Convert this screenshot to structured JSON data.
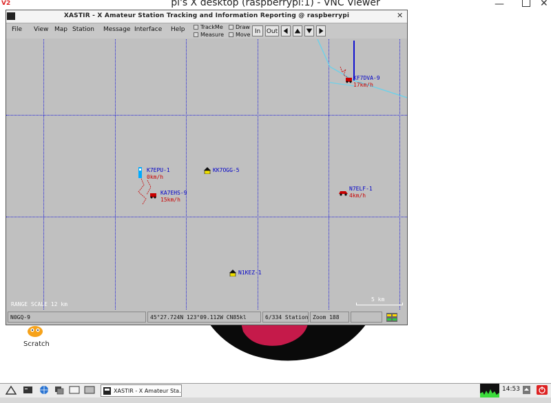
{
  "vnc": {
    "title": "pi's X desktop (raspberrypi:1) - VNC Viewer",
    "app_icon_text": "V2",
    "minimize_glyph": "—",
    "close_glyph": "✕"
  },
  "desktop": {
    "scratch_label": "Scratch"
  },
  "xastir": {
    "title": "XASTIR - X Amateur Station Tracking and Information Reporting @ raspberrypi",
    "close_glyph": "✕",
    "menus": [
      "File",
      "View",
      "Map",
      "Station",
      "Message",
      "Interface",
      "Help"
    ],
    "checkboxes": [
      {
        "label": "TrackMe"
      },
      {
        "label": "Draw"
      },
      {
        "label": "Measure"
      },
      {
        "label": "Move"
      }
    ],
    "zoom_in_label": "In",
    "zoom_out_label": "Out",
    "arrows": [
      "left",
      "up",
      "down",
      "right"
    ],
    "map": {
      "range_scale": "RANGE SCALE 12 km",
      "scale_bar_label": "5 km",
      "stations": [
        {
          "callsign": "KF7DVA-9",
          "speed": "17km/h",
          "icon": "car-icon",
          "color": "#c80000"
        },
        {
          "callsign": "K7EPU-1",
          "speed": "0km/h",
          "icon": "cyan-marker-icon",
          "color": "#00aaff"
        },
        {
          "callsign": "KK7OGG-5",
          "speed": "",
          "icon": "house-icon",
          "color": "#f0e000"
        },
        {
          "callsign": "KA7EHS-9",
          "speed": "15km/h",
          "icon": "car-icon",
          "color": "#c80000"
        },
        {
          "callsign": "N7ELF-1",
          "speed": "4km/h",
          "icon": "car-icon",
          "color": "#c80000"
        },
        {
          "callsign": "N1KEZ-1",
          "speed": "",
          "icon": "house-icon",
          "color": "#f0e000"
        }
      ]
    },
    "status": {
      "callsign": "N0GQ-9",
      "coords": "45°27.724N  123°09.112W  CN85kl",
      "stations": "6/334 Station",
      "zoom": "Zoom 188"
    }
  },
  "taskbar": {
    "xastir_task_label": "XASTIR - X Amateur Sta...",
    "clock": "14:53"
  }
}
